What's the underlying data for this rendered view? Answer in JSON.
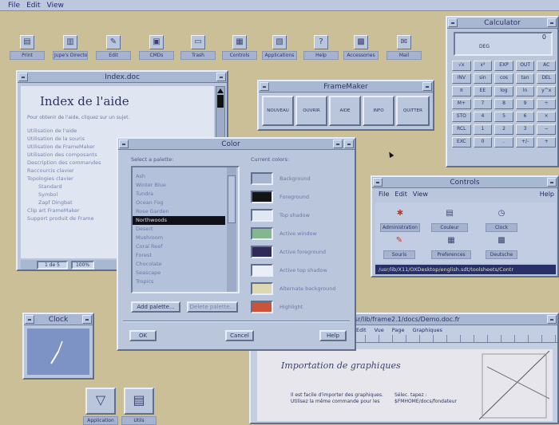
{
  "menubar": {
    "items": [
      "File",
      "Edit",
      "View"
    ]
  },
  "desktop_icons": [
    {
      "label": "Print",
      "icon": "printer-icon",
      "glyph": "▤"
    },
    {
      "label": "Jupe's Directory",
      "icon": "folder-icon",
      "glyph": "▥"
    },
    {
      "label": "Edit",
      "icon": "edit-icon",
      "glyph": "✎"
    },
    {
      "label": "CMDs",
      "icon": "terminal-icon",
      "glyph": "▣"
    },
    {
      "label": "Trash",
      "icon": "trash-icon",
      "glyph": "▭"
    },
    {
      "label": "Controls",
      "icon": "controls-icon",
      "glyph": "▦"
    },
    {
      "label": "Applications",
      "icon": "applications-icon",
      "glyph": "▧"
    },
    {
      "label": "Help",
      "icon": "help-icon",
      "glyph": "?"
    },
    {
      "label": "Accessories",
      "icon": "accessories-icon",
      "glyph": "▩"
    },
    {
      "label": "Mail",
      "icon": "mail-icon",
      "glyph": "✉"
    }
  ],
  "index_window": {
    "title": "Index.doc",
    "heading": "Index de l'aide",
    "intro": "Pour obtenir de l'aide, cliquez sur un sujet.",
    "items": [
      "Utilisation de l'aide",
      "Utilisation de la souris",
      "Utilisation de FrameMaker",
      "Utilisation des composants",
      "Description des commandes",
      "Raccourcis clavier",
      "Topologies clavier"
    ],
    "subitems": [
      "Standard",
      "Symbol",
      "Zapf Dingbat"
    ],
    "items2": [
      "Clip art FrameMaker",
      "Support produit de Frame"
    ],
    "status_page": "1 de 5",
    "status_zoom": "100%"
  },
  "framemaker": {
    "title": "FrameMaker",
    "buttons": [
      "NOUVEAU",
      "OUVRIR",
      "AIDE",
      "INFO",
      "QUITTER"
    ]
  },
  "calculator": {
    "title": "Calculator",
    "display": "0",
    "mode": "DEG",
    "keys": [
      "√x",
      "x²",
      "EXP",
      "OUT",
      "AC",
      "INV",
      "sin",
      "cos",
      "tan",
      "DEL",
      "π",
      "EE",
      "log",
      "ln",
      "y^x",
      "M+",
      "7",
      "8",
      "9",
      "÷",
      "STO",
      "4",
      "5",
      "6",
      "×",
      "RCL",
      "1",
      "2",
      "3",
      "−",
      "EXC",
      "0",
      ".",
      "+/-",
      "+"
    ]
  },
  "color_dialog": {
    "title": "Color",
    "palette_label": "Select a palette:",
    "palettes": [
      "Ash",
      "Winter Blue",
      "Tundra",
      "Ocean Fog",
      "Rose Garden",
      "Northwoods",
      "Desert",
      "Mushroom",
      "Coral Reef",
      "Forest",
      "Chocolate",
      "Seascape",
      "Tropics"
    ],
    "selected_palette": "Northwoods",
    "current_label": "Current colors:",
    "colors": [
      {
        "name": "Background",
        "hex": "#a8b6d2"
      },
      {
        "name": "Foreground",
        "hex": "#141414"
      },
      {
        "name": "Top shadow",
        "hex": "#dfe7f2"
      },
      {
        "name": "Active window",
        "hex": "#84b68f"
      },
      {
        "name": "Active foreground",
        "hex": "#2f2a58"
      },
      {
        "name": "Active top shadow",
        "hex": "#e9eef8"
      },
      {
        "name": "Alternate background",
        "hex": "#ded7b4"
      },
      {
        "name": "Highlight",
        "hex": "#c9543a"
      }
    ],
    "add_button": "Add palette...",
    "delete_button": "Delete palette...",
    "ok_button": "OK",
    "cancel_button": "Cancel",
    "help_button": "Help"
  },
  "controls_window": {
    "title": "Controls",
    "menu": [
      "File",
      "Edit",
      "View"
    ],
    "help": "Help",
    "icons": [
      {
        "label": "Administration",
        "icon": "administration-icon"
      },
      {
        "label": "Couleur",
        "icon": "color-icon"
      },
      {
        "label": "Clock",
        "icon": "clock-icon"
      },
      {
        "label": "Souris",
        "icon": "mouse-icon"
      },
      {
        "label": "Preferences",
        "icon": "preferences-icon"
      },
      {
        "label": "Deutsche",
        "icon": "deutsche-icon"
      }
    ],
    "path": "/usr/lib/X11/OXDesktop/english.sdt/toolsheets/Contr"
  },
  "clock": {
    "title": "Clock"
  },
  "doc_window": {
    "title": "/usr/lib/frame2.1/docs/Demo.doc.fr",
    "menu": [
      "Edit",
      "Vue",
      "Page",
      "Graphiques"
    ],
    "heading": "Importation de graphiques",
    "col1": "Il est facile d'importer des graphiques. Utilisez la même commande pour les",
    "col2": "Sélec. tapez : $FMHOME/docs/fondateur"
  },
  "bottom_icons": [
    {
      "label": "Application",
      "icon": "application-launcher-icon"
    },
    {
      "label": "Utils",
      "icon": "utils-icon"
    }
  ]
}
